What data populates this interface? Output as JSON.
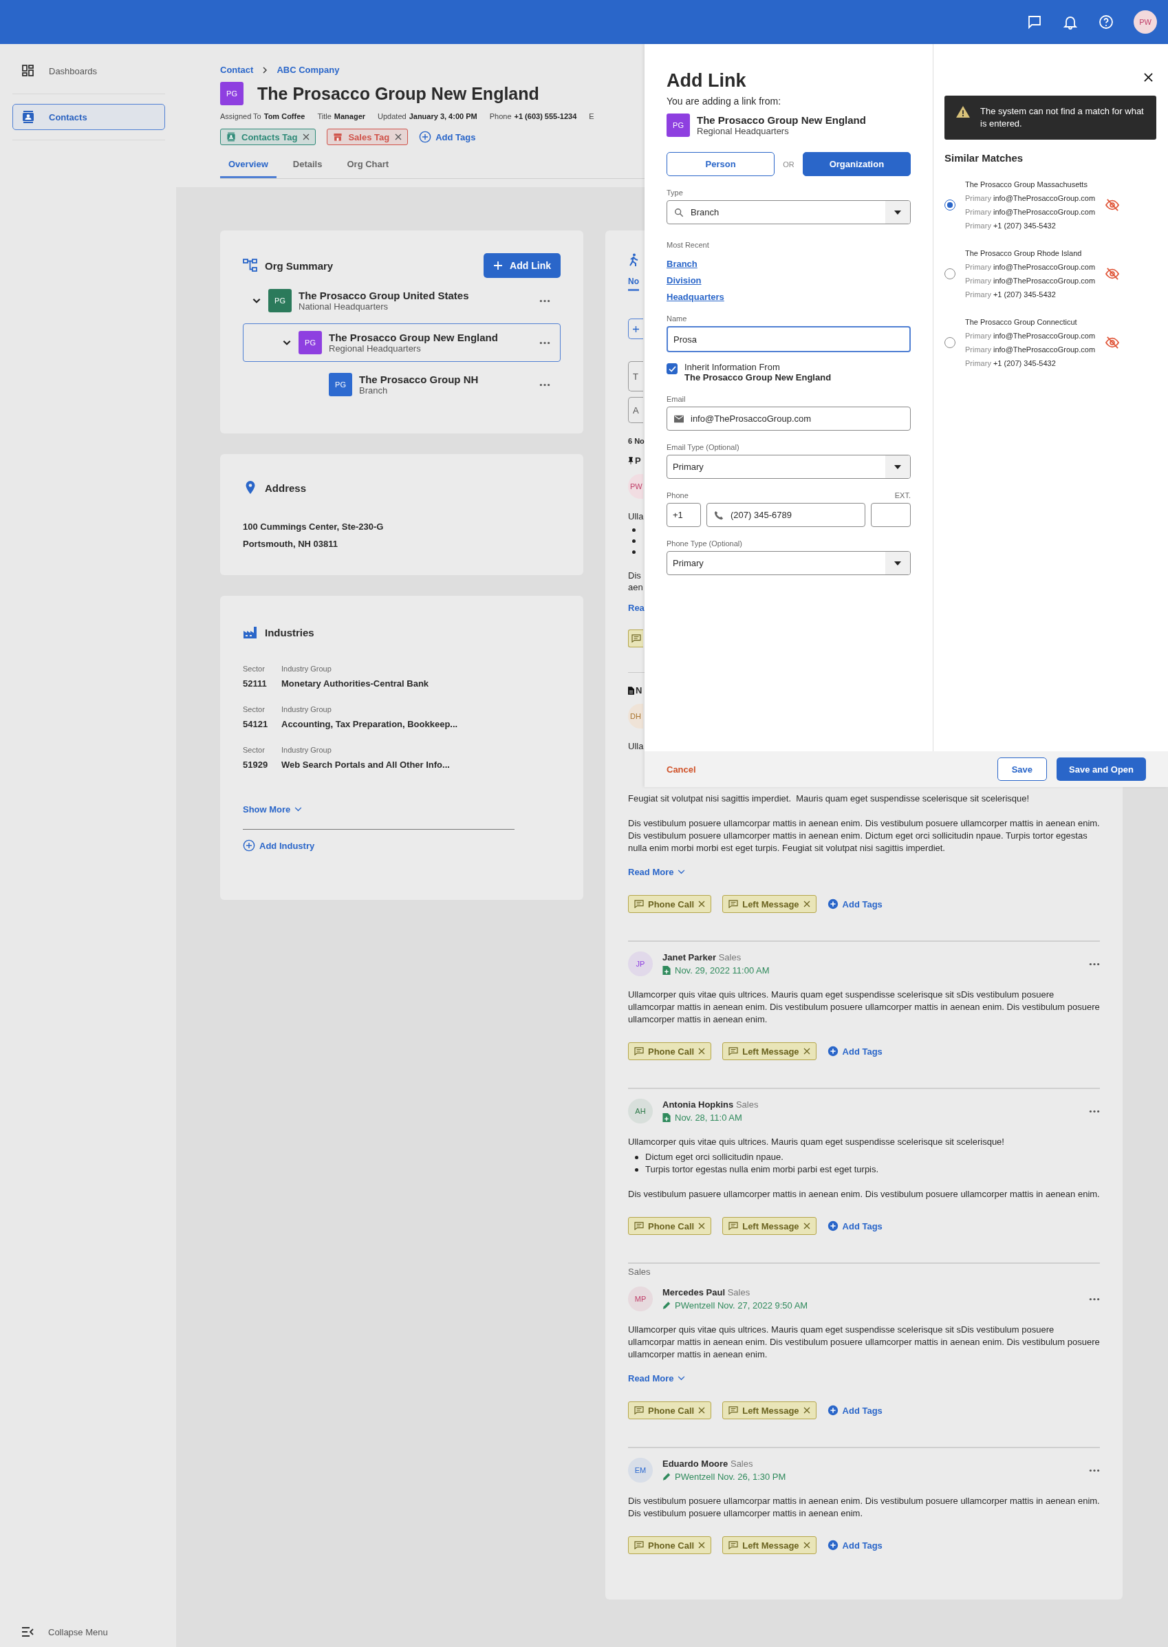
{
  "top_bar": {
    "avatar": "PW"
  },
  "sidebar": {
    "items": [
      {
        "label": "Dashboards",
        "kind": "dashboard",
        "selected": false
      },
      {
        "label": "Contacts",
        "kind": "contacts",
        "selected": true
      }
    ],
    "collapse": "Collapse Menu"
  },
  "breadcrumb": [
    "Contact",
    "ABC Company"
  ],
  "header": {
    "initials": "PG",
    "title": "The Prosacco Group New England",
    "meta": [
      {
        "label": "Assigned To",
        "value": "Tom Coffee"
      },
      {
        "label": "Title",
        "value": "Manager"
      },
      {
        "label": "Updated",
        "value": "January 3, 4:00 PM"
      },
      {
        "label": "Phone",
        "value": "+1 (603) 555-1234"
      },
      {
        "label": "E"
      }
    ],
    "tags": [
      {
        "label": "Contacts Tag",
        "kind": "contacts",
        "color": "#2e8a78"
      },
      {
        "label": "Sales Tag",
        "kind": "store",
        "color": "#d0534a"
      }
    ],
    "add_tags": "Add Tags"
  },
  "tabs": [
    {
      "label": "Overview",
      "selected": true
    },
    {
      "label": "Details",
      "selected": false
    },
    {
      "label": "Org Chart",
      "selected": false
    }
  ],
  "org_summary": {
    "title": "Org Summary",
    "add_link": "Add Link",
    "nodes": [
      {
        "initials": "PG",
        "name": "The Prosacco Group United States",
        "type": "National Headquarters",
        "color": "#2b7a5b",
        "expanded": true,
        "selected": false,
        "children": [
          {
            "initials": "PG",
            "name": "The Prosacco Group New England",
            "type": "Regional Headquarters",
            "color": "#8e3fe0",
            "expanded": true,
            "selected": true,
            "children": [
              {
                "initials": "PG",
                "name": "The Prosacco Group NH",
                "type": "Branch",
                "color": "#2d6ad0",
                "selected": false
              }
            ]
          }
        ]
      }
    ]
  },
  "address": {
    "title": "Address",
    "lines": [
      "100 Cummings Center, Ste-230-G",
      "Portsmouth, NH 03811"
    ]
  },
  "industries": {
    "title": "Industries",
    "rows": [
      {
        "sector_label": "Sector",
        "group_label": "Industry Group",
        "sector": "52111",
        "group": "Monetary Authorities-Central Bank"
      },
      {
        "sector_label": "Sector",
        "group_label": "Industry Group",
        "sector": "54121",
        "group": "Accounting, Tax Preparation, Bookkeep..."
      },
      {
        "sector_label": "Sector",
        "group_label": "Industry Group",
        "sector": "51929",
        "group": "Web Search Portals and All Other Info..."
      }
    ],
    "show_more": "Show More",
    "add_industry": "Add Industry"
  },
  "notes_strip": {
    "tab": "No",
    "input_1": "T",
    "input_2": "A",
    "count": "6 No",
    "pinned": "P",
    "avatar_1": "PW",
    "text_1": "Ulla",
    "text_2": "Dis",
    "text_3": "aen",
    "link": "Rea",
    "section": "N",
    "avatar_2": "DH",
    "text_4": "Ulla"
  },
  "note_continued": {
    "paragraphs": [
      "Feugiat sit volutpat nisi sagittis imperdiet.  Mauris quam eget suspendisse scelerisque sit scelerisque!",
      "Dis vestibulum posuere ullamcorpar mattis in aenean enim. Dis vestibulum posuere ullamcorper mattis in aenean enim. Dis vestibulum posuere ullamcorper mattis in aenean enim. Dictum eget orci sollicitudin npaue. Turpis tortor egestas nulla enim morbi morbi est eget turpis. Feugiat sit volutpat nisi sagittis imperdiet."
    ],
    "read_more": "Read More",
    "tags": [
      "Phone Call",
      "Left Message"
    ],
    "add_tags": "Add Tags"
  },
  "notes": [
    {
      "initials": "JP",
      "color": "#8e3fe0",
      "author": "Janet Parker",
      "role": "Sales",
      "date": {
        "kind": "document",
        "text": "Nov. 29, 2022 11:00 AM"
      },
      "blocks": [
        {
          "kind": "p",
          "text": "Ullamcorper quis vitae quis ultrices. Mauris quam eget suspendisse scelerisque sit sDis vestibulum posuere ullamcorpar mattis in aenean enim. Dis vestibulum posuere ullamcorper mattis in aenean enim. Dis vestibulum posuere ullamcorper mattis in aenean enim."
        }
      ],
      "tags": [
        "Phone Call",
        "Left Message"
      ],
      "add_tags": "Add Tags"
    },
    {
      "initials": "AH",
      "color": "#2f7a4a",
      "author": "Antonia Hopkins",
      "role": "Sales",
      "date": {
        "kind": "document",
        "text": "Nov. 28, 11:0 AM"
      },
      "blocks": [
        {
          "kind": "p",
          "text": "Ullamcorper quis vitae quis ultrices. Mauris quam eget suspendisse scelerisque sit scelerisque!"
        },
        {
          "kind": "list",
          "items": [
            "Dictum eget orci sollicitudin npaue.",
            "Turpis tortor egestas nulla enim morbi parbi est eget turpis."
          ]
        },
        {
          "kind": "p",
          "text": "Dis vestibulum pasuere ullamcorper mattis in aenean enim. Dis vestibulum posuere ullamcorper mattis in aenean enim."
        }
      ],
      "tags": [
        "Phone Call",
        "Left Message"
      ],
      "add_tags": "Add Tags"
    },
    {
      "group": "Sales",
      "initials": "MP",
      "color": "#c0406a",
      "author": "Mercedes Paul",
      "role": "Sales",
      "date": {
        "kind": "edit",
        "text": "PWentzell Nov. 27, 2022 9:50 AM"
      },
      "blocks": [
        {
          "kind": "p",
          "text": "Ullamcorper quis vitae quis ultrices. Mauris quam eget suspendisse scelerisque sit sDis vestibulum posuere ullamcorpar mattis in aenean enim. Dis vestibulum posuere ullamcorper mattis in aenean enim. Dis vestibulum posuere ullamcorper mattis in aenean enim."
        }
      ],
      "read_more": "Read More",
      "tags": [
        "Phone Call",
        "Left Message"
      ],
      "add_tags": "Add Tags"
    },
    {
      "initials": "EM",
      "color": "#2d6ad0",
      "author": "Eduardo Moore",
      "role": "Sales",
      "date": {
        "kind": "edit",
        "text": "PWentzell Nov. 26, 1:30 PM"
      },
      "blocks": [
        {
          "kind": "p",
          "text": "Dis vestibulum posuere ullamcorpar mattis in aenean enim. Dis vestibulum posuere ullamcorper mattis in aenean enim. Dis vestibulum posuere ullamcorper mattis in aenean enim."
        }
      ],
      "tags": [
        "Phone Call",
        "Left Message"
      ],
      "add_tags": "Add Tags"
    }
  ],
  "add_link": {
    "title": "Add Link",
    "subtitle": "You are adding a link from:",
    "source": {
      "initials": "PG",
      "name": "The Prosacco Group New England",
      "type": "Regional Headquarters"
    },
    "link_types": [
      {
        "label": "Person",
        "selected": false
      },
      {
        "label": "Organization",
        "selected": true
      }
    ],
    "or": "OR",
    "type_field": {
      "label": "Type",
      "value": "Branch"
    },
    "recent_label": "Most Recent",
    "recent": [
      "Branch",
      "Division",
      "Headquarters"
    ],
    "name_field": {
      "label": "Name",
      "value": "Prosa",
      "focused": true
    },
    "inherit": {
      "checked": true,
      "label": "Inherit Information From",
      "source": "The Prosacco Group New England"
    },
    "email": {
      "label": "Email",
      "value": "info@TheProsaccoGroup.com"
    },
    "email_type": {
      "label": "Email Type (Optional)",
      "value": "Primary"
    },
    "phone": {
      "label": "Phone",
      "code": "+1",
      "value": "(207) 345-6789",
      "ext_label": "EXT."
    },
    "phone_type": {
      "label": "Phone Type (Optional)",
      "value": "Primary"
    },
    "cancel": "Cancel",
    "save": "Save",
    "save_open": "Save and Open"
  },
  "matches": {
    "alert": "The system can not find a match for what is entered.",
    "title": "Similar Matches",
    "items": [
      {
        "name": "The Prosacco Group Massachusetts",
        "selected": true,
        "lines": [
          {
            "label": "Primary",
            "value": "info@TheProsaccoGroup.com"
          },
          {
            "label": "Primary",
            "value": "info@TheProsaccoGroup.com"
          },
          {
            "label": "Primary",
            "value": "+1 (207) 345-5432"
          }
        ]
      },
      {
        "name": "The Prosacco Group Rhode Island",
        "selected": false,
        "lines": [
          {
            "label": "Primary",
            "value": "info@TheProsaccoGroup.com"
          },
          {
            "label": "Primary",
            "value": "info@TheProsaccoGroup.com"
          },
          {
            "label": "Primary",
            "value": "+1 (207) 345-5432"
          }
        ]
      },
      {
        "name": "The Prosacco Group Connecticut",
        "selected": false,
        "lines": [
          {
            "label": "Primary",
            "value": "info@TheProsaccoGroup.com"
          },
          {
            "label": "Primary",
            "value": "info@TheProsaccoGroup.com"
          },
          {
            "label": "Primary",
            "value": "+1 (207) 345-5432"
          }
        ]
      }
    ]
  }
}
